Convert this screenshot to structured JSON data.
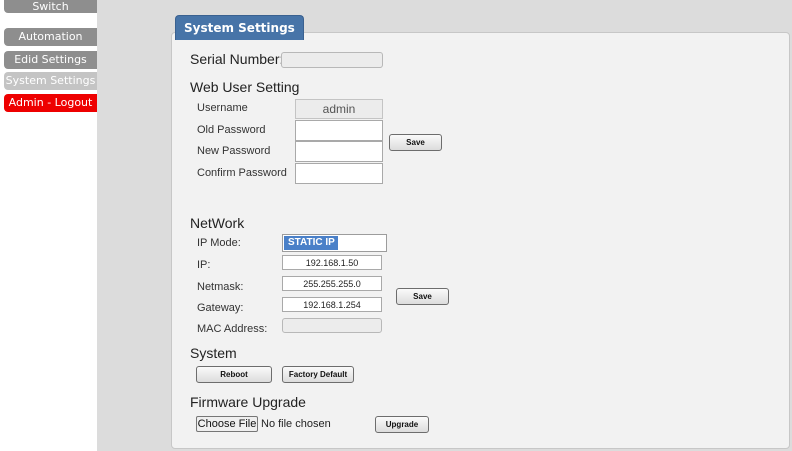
{
  "sidebar": {
    "items": [
      {
        "label": "Switch"
      },
      {
        "label": "Automation"
      },
      {
        "label": "Edid Settings"
      },
      {
        "label": "System Settings"
      },
      {
        "label": "Admin - Logout"
      }
    ]
  },
  "panel": {
    "title": "System Settings",
    "serial": {
      "label": "Serial Number:",
      "value": ""
    },
    "web_user": {
      "heading": "Web User Setting",
      "username_label": "Username",
      "username_value": "admin",
      "old_password_label": "Old Password",
      "new_password_label": "New Password",
      "confirm_password_label": "Confirm Password",
      "save_label": "Save"
    },
    "network": {
      "heading": "NetWork",
      "ip_mode_label": "IP Mode:",
      "ip_mode_value": "STATIC IP",
      "ip_label": "IP:",
      "ip_value": "192.168.1.50",
      "netmask_label": "Netmask:",
      "netmask_value": "255.255.255.0",
      "gateway_label": "Gateway:",
      "gateway_value": "192.168.1.254",
      "mac_label": "MAC Address:",
      "mac_value": "",
      "save_label": "Save"
    },
    "system": {
      "heading": "System",
      "reboot_label": "Reboot",
      "factory_default_label": "Factory Default"
    },
    "firmware": {
      "heading": "Firmware Upgrade",
      "choose_file_label": "Choose File",
      "no_file_text": "No file chosen",
      "upgrade_label": "Upgrade"
    }
  },
  "colors": {
    "tab_blue": "#4774a8",
    "nav_dark": "#8e8e8e",
    "nav_active": "#c4c4c4",
    "logout_red": "#ee0000",
    "select_blue": "#4a80c8"
  }
}
